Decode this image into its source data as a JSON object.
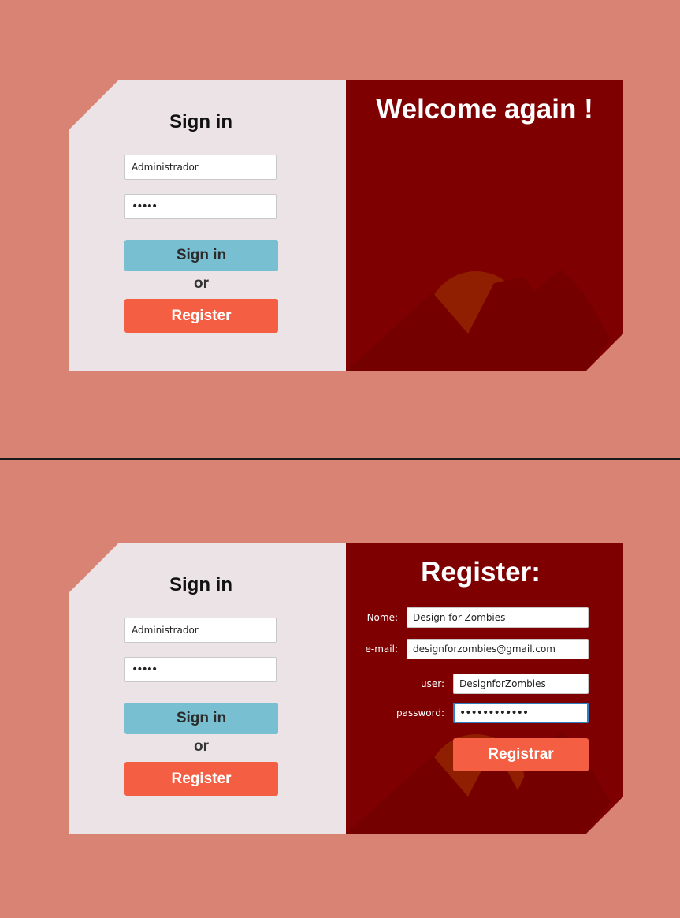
{
  "colors": {
    "background": "#d98375",
    "panel_left": "#ece3e6",
    "panel_right": "#7e0000",
    "signin_button": "#78bfd2",
    "register_button": "#f45f43",
    "focus_border": "#2f7fc1"
  },
  "screen1": {
    "signin": {
      "title": "Sign in",
      "username_value": "Administrador",
      "password_value": "•••••",
      "signin_label": "Sign in",
      "or_label": "or",
      "register_label": "Register"
    },
    "welcome": {
      "title": "Welcome again !"
    }
  },
  "screen2": {
    "signin": {
      "title": "Sign in",
      "username_value": "Administrador",
      "password_value": "•••••",
      "signin_label": "Sign in",
      "or_label": "or",
      "register_label": "Register"
    },
    "register": {
      "title": "Register:",
      "name_label": "Nome:",
      "name_value": "Design for Zombies",
      "email_label": "e-mail:",
      "email_value": "designforzombies@gmail.com",
      "user_label": "user:",
      "user_value": "DesignforZombies",
      "password_label": "password:",
      "password_value": "••••••••••••",
      "submit_label": "Registrar"
    }
  }
}
